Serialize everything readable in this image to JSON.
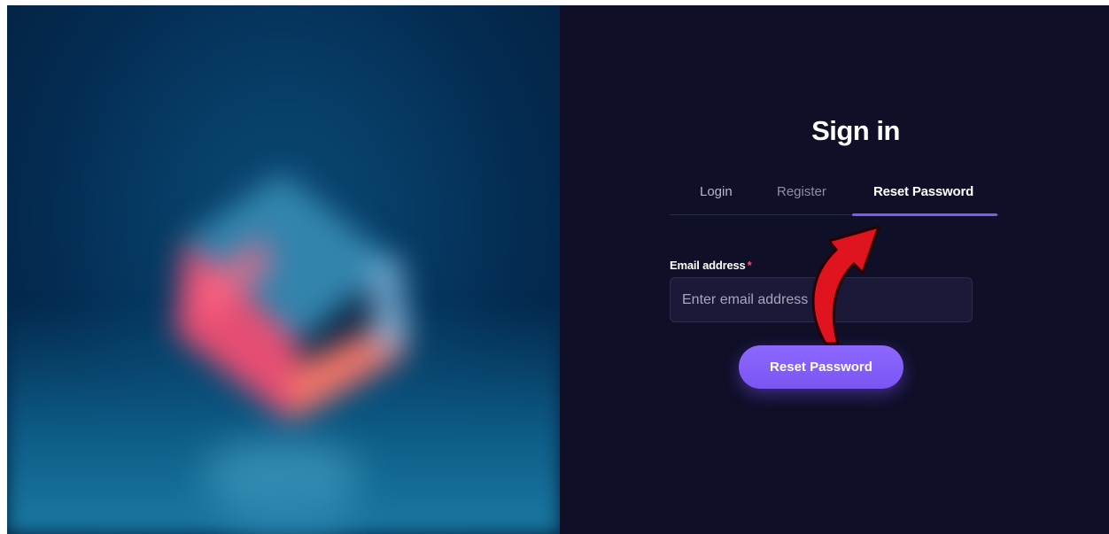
{
  "auth": {
    "title": "Sign in",
    "tabs": [
      {
        "label": "Login"
      },
      {
        "label": "Register"
      },
      {
        "label": "Reset Password"
      }
    ],
    "active_tab": "Reset Password",
    "email": {
      "label": "Email address",
      "required_marker": "*",
      "placeholder": "Enter email address",
      "value": ""
    },
    "submit_label": "Reset Password"
  },
  "colors": {
    "panel_background": "#0f0f28",
    "accent": "#7b5cf0",
    "required": "#ff4d6d",
    "annotation_arrow": "#e0141e"
  },
  "icons": {
    "annotation": "red-curved-arrow-icon"
  }
}
